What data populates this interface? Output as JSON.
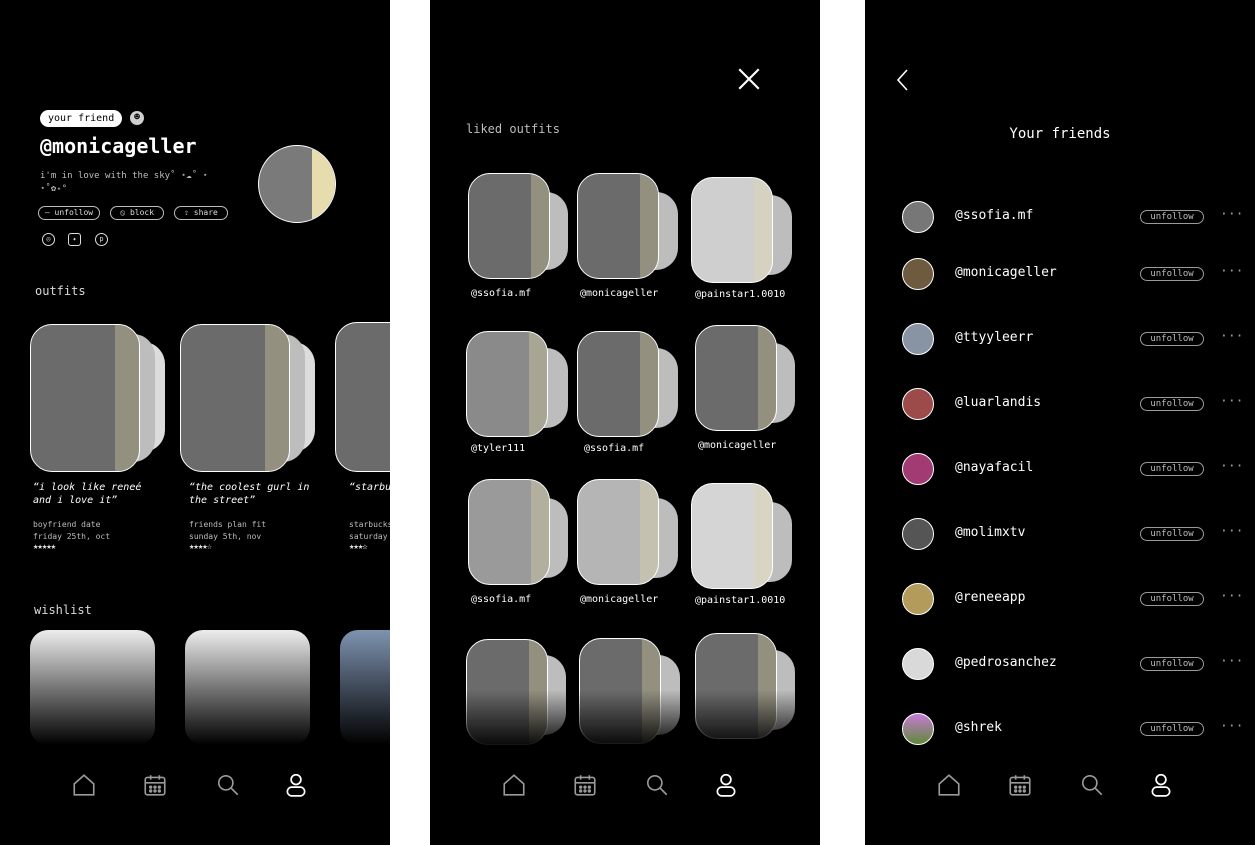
{
  "profile": {
    "badge": "your friend",
    "emoji": "☻",
    "handle": "@monicageller",
    "bio": "i'm in love with the sky˚ ⋆☁︎˚ ⋆ ⋆˚✿˖°",
    "actions": {
      "unfollow": "– unfollow",
      "block": "⦸ block",
      "share": "⇪ share"
    },
    "social": [
      "instagram-icon",
      "twitter-icon",
      "pinterest-icon"
    ],
    "outfits_title": "outfits",
    "outfits": [
      {
        "caption": "“i look like reneé and i love it”",
        "occasion": "boyfriend date",
        "date": "friday 25th, oct",
        "rating": "★★★★★"
      },
      {
        "caption": "“the coolest gurl in the street”",
        "occasion": "friends plan fit",
        "date": "sunday 5th, nov",
        "rating": "★★★★☆"
      },
      {
        "caption": "“starbu",
        "occasion": "starbucks",
        "date": "saturday",
        "rating": "★★★✫"
      }
    ],
    "wishlist_title": "wishlist"
  },
  "liked": {
    "title": "liked outfits",
    "users": [
      "@ssofia.mf",
      "@monicageller",
      "@painstar1.0010",
      "@tyler111",
      "@ssofia.mf",
      "@monicageller",
      "@ssofia.mf",
      "@monicageller",
      "@painstar1.0010"
    ]
  },
  "friends": {
    "title": "Your friends",
    "unfollow_label": "unfollow",
    "more_label": "···",
    "list": [
      "@ssofia.mf",
      "@monicageller",
      "@ttyyleerr",
      "@luarlandis",
      "@nayafacil",
      "@molimxtv",
      "@reneeapp",
      "@pedrosanchez",
      "@shrek"
    ]
  },
  "nav": [
    "home-icon",
    "calendar-icon",
    "search-icon",
    "profile-icon"
  ]
}
